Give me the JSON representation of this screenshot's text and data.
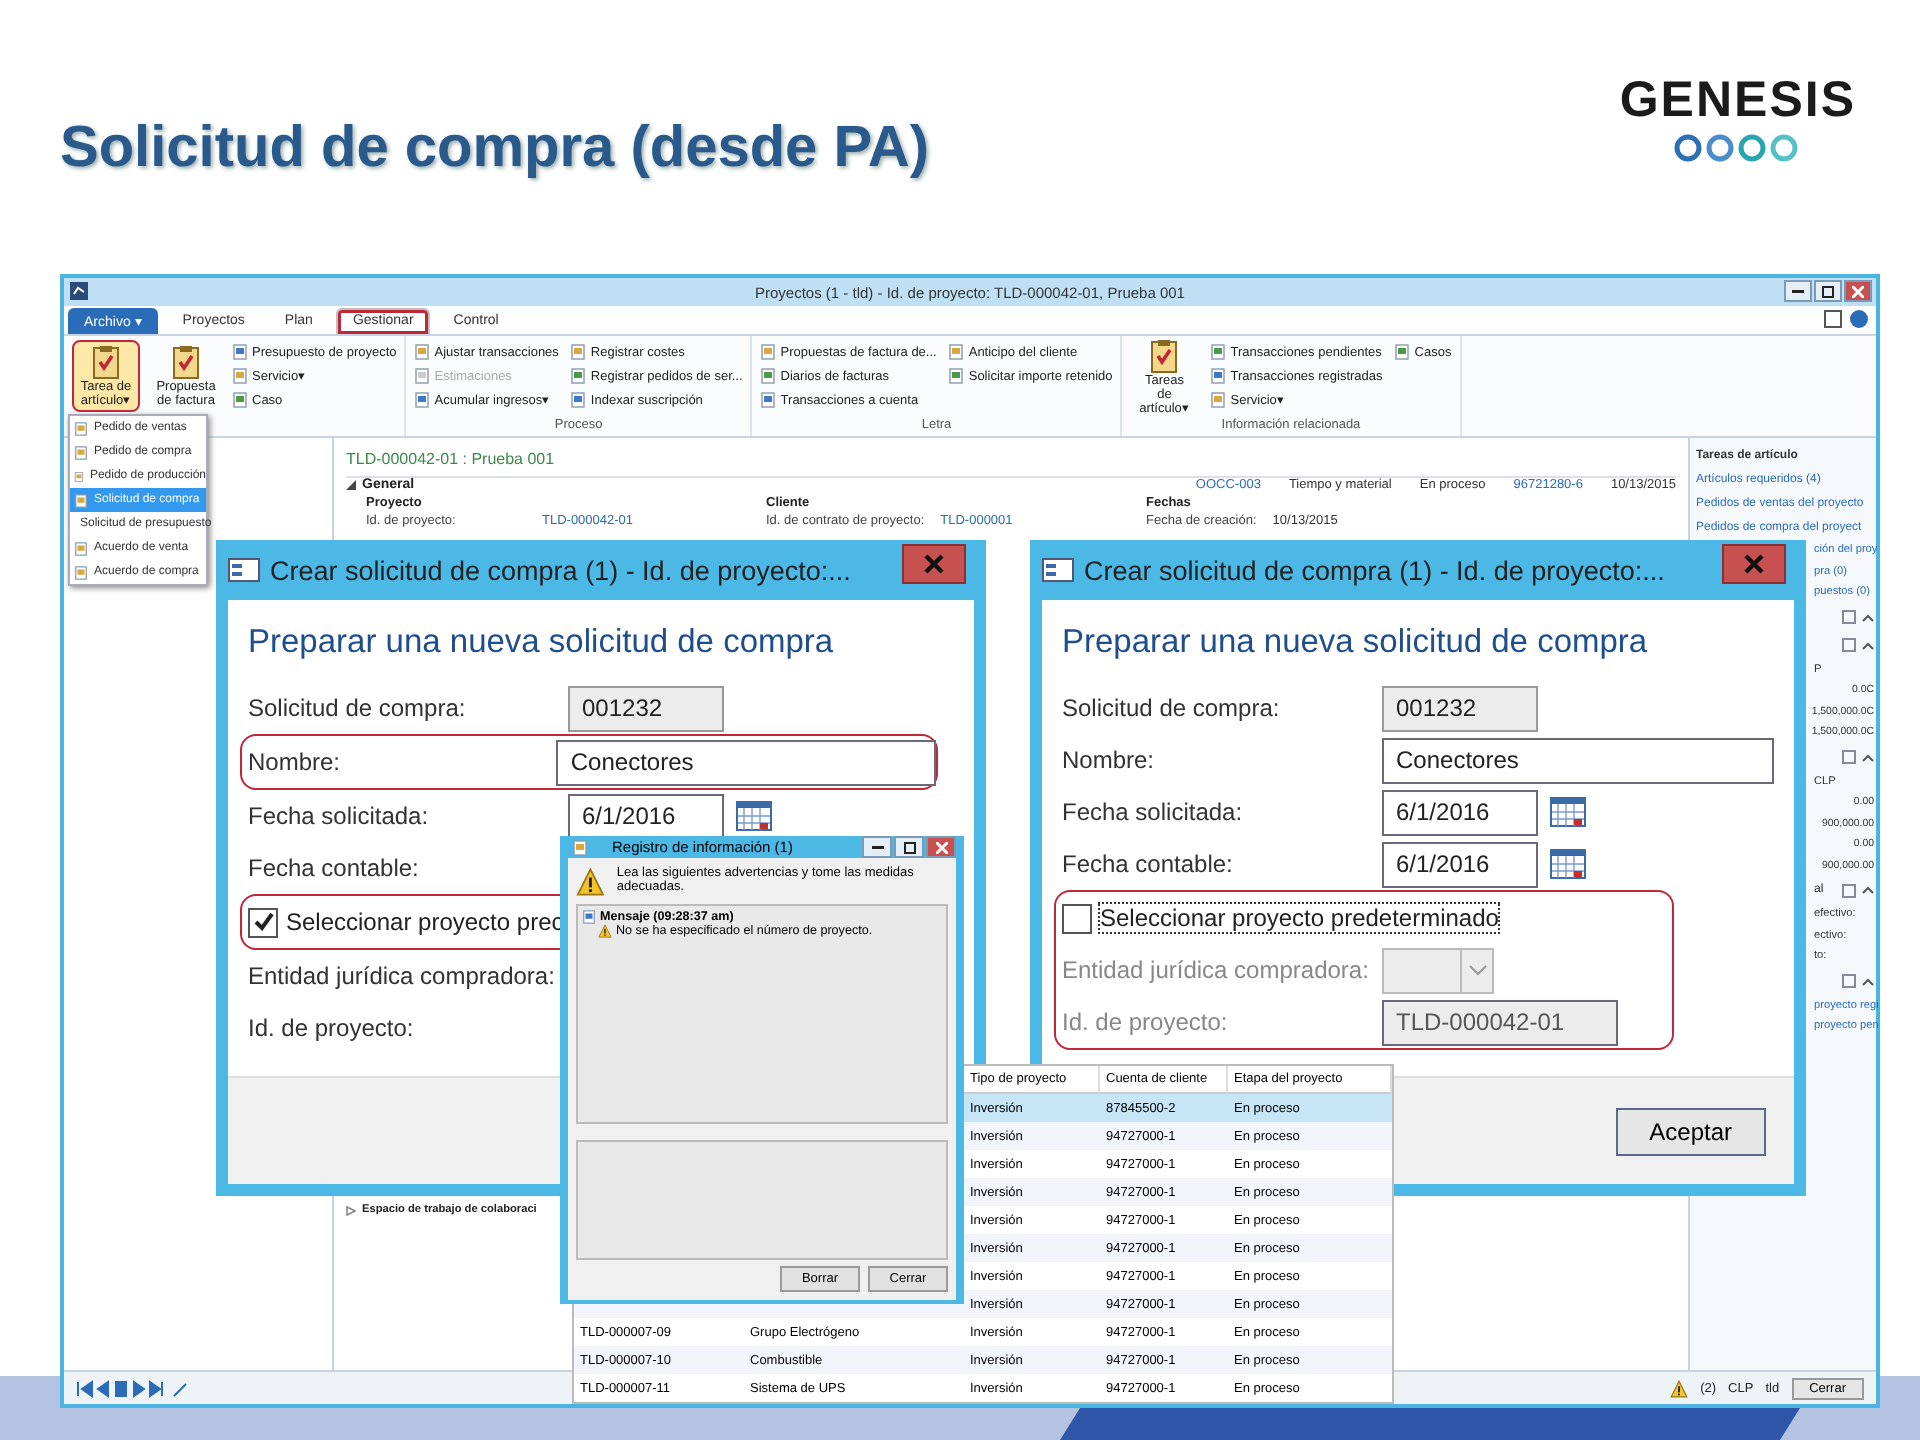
{
  "slide": {
    "title": "Solicitud de compra (desde PA)",
    "logo": {
      "text": "GENESIS"
    }
  },
  "app": {
    "title": "Proyectos (1 - tld) - Id. de proyecto: TLD-000042-01, Prueba 001",
    "menu_tabs": [
      {
        "label": "Archivo ▾",
        "kind": "file"
      },
      {
        "label": "Proyectos",
        "kind": "tab",
        "selected": false,
        "highlighted": false
      },
      {
        "label": "Plan",
        "kind": "tab",
        "selected": false,
        "highlighted": false
      },
      {
        "label": "Gestionar",
        "kind": "tab",
        "selected": true,
        "highlighted": true
      },
      {
        "label": "Control",
        "kind": "tab",
        "selected": false,
        "highlighted": false
      }
    ],
    "ribbon_groups": [
      {
        "items": [
          {
            "label": "Tarea de artículo▾",
            "kind": "large",
            "highlighted": true,
            "disabled": false
          },
          {
            "label": "Propuesta de factura",
            "kind": "large",
            "highlighted": false,
            "disabled": false
          },
          {
            "label": "Presupuesto de proyecto",
            "kind": "small",
            "highlighted": false,
            "disabled": false
          },
          {
            "label": "Servicio▾",
            "kind": "small",
            "highlighted": false,
            "disabled": false
          },
          {
            "label": "Caso",
            "kind": "small",
            "highlighted": false,
            "disabled": false
          }
        ]
      },
      {
        "label": "Proceso",
        "items": [
          {
            "label": "Ajustar transacciones",
            "kind": "small",
            "highlighted": false,
            "disabled": false
          },
          {
            "label": "Estimaciones",
            "kind": "small",
            "highlighted": false,
            "disabled": true
          },
          {
            "label": "Acumular ingresos▾",
            "kind": "small",
            "highlighted": false,
            "disabled": false
          },
          {
            "label": "Registrar costes",
            "kind": "small",
            "highlighted": false,
            "disabled": false
          },
          {
            "label": "Registrar pedidos de ser...",
            "kind": "small",
            "highlighted": false,
            "disabled": false
          },
          {
            "label": "Indexar suscripción",
            "kind": "small",
            "highlighted": false,
            "disabled": false
          }
        ]
      },
      {
        "label": "Letra",
        "items": [
          {
            "label": "Propuestas de factura de...",
            "kind": "small",
            "highlighted": false,
            "disabled": false
          },
          {
            "label": "Diarios de facturas",
            "kind": "small",
            "highlighted": false,
            "disabled": false
          },
          {
            "label": "Transacciones a cuenta",
            "kind": "small",
            "highlighted": false,
            "disabled": false
          },
          {
            "label": "Anticipo del cliente",
            "kind": "small",
            "highlighted": false,
            "disabled": false
          },
          {
            "label": "Solicitar importe retenido",
            "kind": "small",
            "highlighted": false,
            "disabled": false
          }
        ]
      },
      {
        "label": "Información relacionada",
        "items": [
          {
            "label": "Tareas de artículo▾",
            "kind": "large",
            "highlighted": false,
            "disabled": false
          },
          {
            "label": "Transacciones pendientes",
            "kind": "small",
            "highlighted": false,
            "disabled": false
          },
          {
            "label": "Transacciones registradas",
            "kind": "small",
            "highlighted": false,
            "disabled": false
          },
          {
            "label": "Servicio▾",
            "kind": "small",
            "highlighted": false,
            "disabled": false
          },
          {
            "label": "Casos",
            "kind": "small",
            "highlighted": false,
            "disabled": false
          }
        ]
      }
    ],
    "dropdown_menu": [
      {
        "label": "Pedido de ventas",
        "selected": false
      },
      {
        "label": "Pedido de compra",
        "selected": false
      },
      {
        "label": "Pedido de producción",
        "selected": false
      },
      {
        "label": "Solicitud de compra",
        "selected": true
      },
      {
        "label": "Solicitud de presupuesto",
        "selected": false
      },
      {
        "label": "Acuerdo de venta",
        "selected": false
      },
      {
        "label": "Acuerdo de compra",
        "selected": false
      }
    ],
    "record": {
      "title": "TLD-000042-01 : Prueba 001",
      "strip": [
        "OOCC-003",
        "Tiempo y material",
        "En proceso",
        "96721280-6",
        "10/13/2015"
      ],
      "section": {
        "label": "General",
        "expanded": true
      },
      "columns": [
        {
          "heading": "Proyecto",
          "label": "Id. de proyecto:",
          "value": "TLD-000042-01",
          "link": true
        },
        {
          "heading": "Cliente",
          "label": "Id. de contrato de proyecto:",
          "value": "TLD-000001",
          "link": true
        },
        {
          "heading": "Fechas",
          "label": "Fecha de creación:",
          "value": "10/13/2015",
          "link": false
        }
      ],
      "collapsed_section": {
        "label": "Espacio de trabajo de colaboraci",
        "expanded": false
      }
    },
    "right_pane": [
      {
        "kind": "header",
        "text": "Tareas de artículo",
        "clipped": false
      },
      {
        "kind": "link",
        "text": "Artículos requeridos (4)",
        "clipped": false
      },
      {
        "kind": "link",
        "text": "Pedidos de ventas del proyecto",
        "clipped": false
      },
      {
        "kind": "link",
        "text": "Pedidos de compra del proyect",
        "clipped": false
      },
      {
        "kind": "link",
        "text": "ción del proy",
        "clipped": true
      },
      {
        "kind": "link",
        "text": "pra (0)",
        "clipped": true
      },
      {
        "kind": "link",
        "text": "puestos (0)",
        "clipped": true
      },
      {
        "kind": "section"
      },
      {
        "kind": "section"
      },
      {
        "kind": "text",
        "text": "P",
        "clipped": true
      },
      {
        "kind": "number",
        "text": "0.0C"
      },
      {
        "kind": "number",
        "text": "1,500,000.0C"
      },
      {
        "kind": "number",
        "text": "1,500,000.0C"
      },
      {
        "kind": "section"
      },
      {
        "kind": "text",
        "text": "CLP",
        "clipped": true
      },
      {
        "kind": "number",
        "text": "0.00"
      },
      {
        "kind": "number",
        "text": "900,000.00"
      },
      {
        "kind": "number",
        "text": "0.00"
      },
      {
        "kind": "number",
        "text": "900,000.00"
      },
      {
        "kind": "section",
        "text": "al"
      },
      {
        "kind": "text",
        "text": "efectivo:",
        "clipped": true
      },
      {
        "kind": "text",
        "text": "ectivo:",
        "clipped": true
      },
      {
        "kind": "text",
        "text": "to:",
        "clipped": true
      },
      {
        "kind": "section"
      },
      {
        "kind": "link",
        "text": "proyecto regi",
        "clipped": true
      },
      {
        "kind": "link",
        "text": "proyecto pen",
        "clipped": true
      }
    ],
    "status_bar": {
      "alerts": "(2)",
      "currency": "CLP",
      "company": "tld",
      "button": "Cerrar"
    }
  },
  "dialogs": [
    {
      "title": "Crear solicitud de compra (1) - Id. de proyecto:...",
      "heading": "Preparar una nueva solicitud de compra",
      "fields": [
        {
          "kind": "field",
          "label": "Solicitud de compra:",
          "value": "001232",
          "readonly": true,
          "disabled": false
        },
        {
          "kind": "highlight_group",
          "fields": [
            {
              "kind": "wide_field",
              "label": "Nombre:",
              "value": "Conectores",
              "readonly": false,
              "disabled": false
            }
          ]
        },
        {
          "kind": "date",
          "label": "Fecha solicitada:",
          "value": "6/1/2016",
          "readonly": false,
          "disabled": false
        },
        {
          "kind": "label",
          "label": "Fecha contable:"
        },
        {
          "kind": "highlight_group",
          "fields": [
            {
              "kind": "checkbox",
              "label": "Seleccionar proyecto prec",
              "checked": true
            }
          ]
        },
        {
          "kind": "label",
          "label": "Entidad jurídica compradora:"
        },
        {
          "kind": "label",
          "label": "Id. de proyecto:"
        }
      ]
    },
    {
      "title": "Crear solicitud de compra (1) - Id. de proyecto:...",
      "heading": "Preparar una nueva solicitud de compra",
      "fields": [
        {
          "kind": "field",
          "label": "Solicitud de compra:",
          "value": "001232",
          "readonly": true,
          "disabled": false
        },
        {
          "kind": "wide_field",
          "label": "Nombre:",
          "value": "Conectores",
          "readonly": false,
          "disabled": false
        },
        {
          "kind": "date",
          "label": "Fecha solicitada:",
          "value": "6/1/2016",
          "readonly": false,
          "disabled": false
        },
        {
          "kind": "date",
          "label": "Fecha contable:",
          "value": "6/1/2016",
          "readonly": false,
          "disabled": false
        },
        {
          "kind": "highlight_group",
          "fields": [
            {
              "kind": "checkbox",
              "label": "Seleccionar proyecto predeterminado",
              "checked": false
            },
            {
              "kind": "dropdown",
              "label": "Entidad jurídica compradora:",
              "disabled": true
            },
            {
              "kind": "field",
              "label": "Id. de proyecto:",
              "value": "TLD-000042-01",
              "readonly": false,
              "disabled": true
            }
          ]
        }
      ],
      "button": "Aceptar"
    }
  ],
  "infolog": {
    "title": "Registro de información (1)",
    "intro": "Lea las siguientes advertencias y tome las medidas adecuadas.",
    "messages": [
      {
        "text": "Mensaje (09:28:37 am)",
        "children": [
          {
            "text": "No se ha especificado el número de proyecto."
          }
        ]
      }
    ],
    "buttons": [
      "Borrar",
      "Cerrar"
    ]
  },
  "grid": {
    "columns": [
      "",
      "",
      "Tipo de proyecto",
      "Cuenta de cliente",
      "Etapa del proyecto"
    ],
    "rows": [
      {
        "cells": [
          "",
          "",
          "Inversión",
          "87845500-2",
          "En proceso"
        ],
        "selected": true
      },
      {
        "cells": [
          "",
          "",
          "Inversión",
          "94727000-1",
          "En proceso"
        ],
        "selected": false
      },
      {
        "cells": [
          "",
          "",
          "Inversión",
          "94727000-1",
          "En proceso"
        ],
        "selected": false
      },
      {
        "cells": [
          "",
          "",
          "Inversión",
          "94727000-1",
          "En proceso"
        ],
        "selected": false
      },
      {
        "cells": [
          "",
          "",
          "Inversión",
          "94727000-1",
          "En proceso"
        ],
        "selected": false
      },
      {
        "cells": [
          "",
          "",
          "Inversión",
          "94727000-1",
          "En proceso"
        ],
        "selected": false
      },
      {
        "cells": [
          "",
          "",
          "Inversión",
          "94727000-1",
          "En proceso"
        ],
        "selected": false
      },
      {
        "cells": [
          "",
          "",
          "Inversión",
          "94727000-1",
          "En proceso"
        ],
        "selected": false
      },
      {
        "cells": [
          "TLD-000007-09",
          "Grupo Electrógeno",
          "Inversión",
          "94727000-1",
          "En proceso"
        ],
        "selected": false
      },
      {
        "cells": [
          "TLD-000007-10",
          "Combustible",
          "Inversión",
          "94727000-1",
          "En proceso"
        ],
        "selected": false
      },
      {
        "cells": [
          "TLD-000007-11",
          "Sistema de UPS",
          "Inversión",
          "94727000-1",
          "En proceso"
        ],
        "selected": false
      }
    ]
  }
}
